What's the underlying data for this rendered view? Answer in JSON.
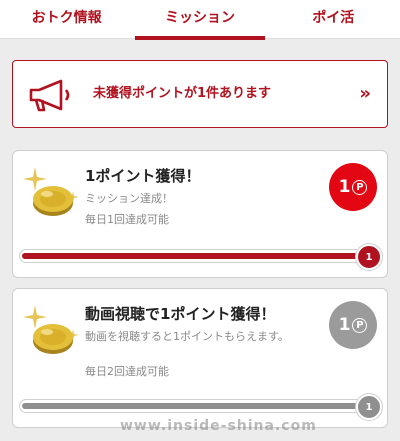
{
  "tabs": [
    {
      "label": "おトク情報",
      "active": false
    },
    {
      "label": "ミッション",
      "active": true
    },
    {
      "label": "ポイ活",
      "active": false
    }
  ],
  "notice": {
    "text": "未獲得ポイントが1件あります",
    "chevron": "»",
    "icon": "megaphone-icon"
  },
  "missions": [
    {
      "title": "1ポイント獲得！",
      "description": "ミッション達成！",
      "frequency": "毎日1回達成可能",
      "points": "1",
      "point_unit": "P",
      "badge_color": "#e30613",
      "progress_value": "1",
      "progress": 1.0,
      "progress_color": "#b1121f"
    },
    {
      "title": "動画視聴で1ポイント獲得！",
      "description": "動画を視聴すると1ポイントもらえます。",
      "frequency": "毎日2回達成可能",
      "points": "1",
      "point_unit": "P",
      "badge_color": "#9b9b9b",
      "progress_value": "1",
      "progress": 1.0,
      "progress_color": "#8f8f8f"
    }
  ],
  "watermark": "www.inside-shina.com",
  "colors": {
    "accent": "#b1121f",
    "background": "#ececec"
  }
}
